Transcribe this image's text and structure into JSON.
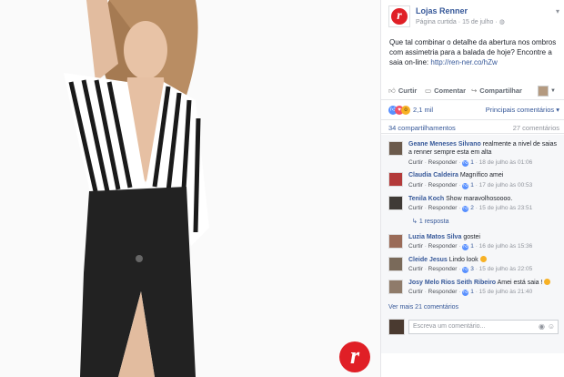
{
  "post": {
    "page_name": "Lojas Renner",
    "meta_label": "Página curtida",
    "date": "15 de julho",
    "text_line": "Que tal combinar o detalhe da abertura nos ombros com assimetria para a balada de hoje? Encontre a saia on-line:",
    "link": "http://ren-ner.co/hZw",
    "logo_letter": "r"
  },
  "actions": {
    "like": "Curtir",
    "comment": "Comentar",
    "share": "Compartilhar"
  },
  "reactions": {
    "count": "2,1 mil",
    "top_comments": "Principais comentários"
  },
  "shares": {
    "shares_label": "34 compartilhamentos",
    "comments_label": "27 comentários"
  },
  "comments": [
    {
      "name": "Geane Meneses Silvano",
      "text": "realmente a nivel de saias a renner sempre esta em alta",
      "like": "Curtir",
      "reply": "Responder",
      "likes": "1",
      "time": "18 de julho às 01:06",
      "avatar_color": "#6b5a4c"
    },
    {
      "name": "Claudia Caldeira",
      "text": "Magnífico amei",
      "like": "Curtir",
      "reply": "Responder",
      "likes": "1",
      "time": "17 de julho às 00:53",
      "avatar_color": "#b33a3a"
    },
    {
      "name": "Tenila Koch",
      "text": "Show maravolhosoooo.",
      "like": "Curtir",
      "reply": "Responder",
      "likes": "2",
      "time": "15 de julho às 23:51",
      "avatar_color": "#3f3a36",
      "replies": "1 resposta"
    },
    {
      "name": "Luzia Matos Silva",
      "text": "gostei",
      "like": "Curtir",
      "reply": "Responder",
      "likes": "1",
      "time": "16 de julho às 15:36",
      "avatar_color": "#9a6b58"
    },
    {
      "name": "Cleide Jesus",
      "text": "Lindo look",
      "like": "Curtir",
      "reply": "Responder",
      "likes": "3",
      "time": "15 de julho às 22:05",
      "avatar_color": "#7a6a5a"
    },
    {
      "name": "Josy Melo Rios Seith Ribeiro",
      "text": "Amei está saia !",
      "like": "Curtir",
      "reply": "Responder",
      "likes": "1",
      "time": "15 de julho às 21:40",
      "avatar_color": "#8f7b6a"
    }
  ],
  "more_comments": "Ver mais 21 comentários",
  "compose": {
    "placeholder": "Escreva um comentário..."
  },
  "colors": {
    "brand_red": "#e01f26",
    "link_blue": "#365899"
  }
}
